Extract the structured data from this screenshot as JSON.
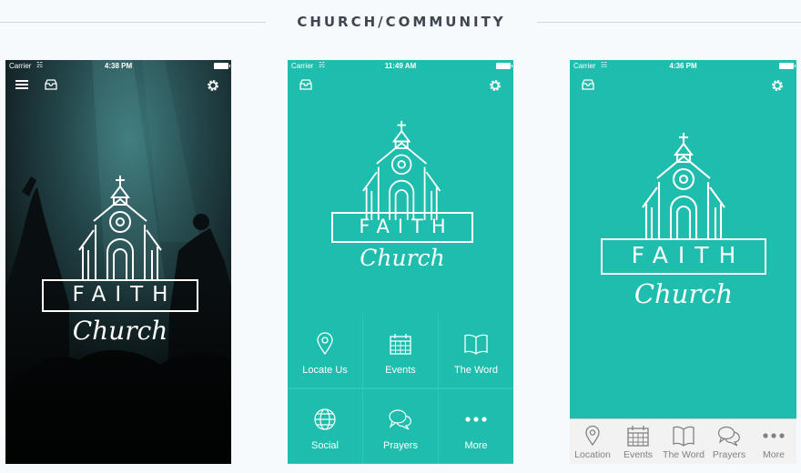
{
  "page_title": "CHURCH/COMMUNITY",
  "screens": [
    {
      "status": {
        "carrier": "Carrier",
        "time": "4:38 PM"
      },
      "logo": {
        "word": "FAITH",
        "script": "Church"
      }
    },
    {
      "status": {
        "carrier": "Carrier",
        "time": "11:49 AM"
      },
      "logo": {
        "word": "FAITH",
        "script": "Church"
      },
      "tiles": [
        {
          "label": "Locate Us",
          "icon": "location-pin-icon"
        },
        {
          "label": "Events",
          "icon": "calendar-icon"
        },
        {
          "label": "The Word",
          "icon": "open-book-icon"
        },
        {
          "label": "Social",
          "icon": "globe-icon"
        },
        {
          "label": "Prayers",
          "icon": "chat-bubbles-icon"
        },
        {
          "label": "More",
          "icon": "more-dots-icon"
        }
      ]
    },
    {
      "status": {
        "carrier": "Carrier",
        "time": "4:36 PM"
      },
      "logo": {
        "word": "FAITH",
        "script": "Church"
      },
      "tabs": [
        {
          "label": "Location",
          "icon": "location-pin-icon"
        },
        {
          "label": "Events",
          "icon": "calendar-icon"
        },
        {
          "label": "The Word",
          "icon": "open-book-icon"
        },
        {
          "label": "Prayers",
          "icon": "chat-bubbles-icon"
        },
        {
          "label": "More",
          "icon": "more-dots-icon"
        }
      ]
    }
  ],
  "colors": {
    "teal": "#1fbdad",
    "teal_light": "#2ec9b8",
    "tabbar_bg": "#f2f2f2",
    "tab_icon": "#808080"
  }
}
